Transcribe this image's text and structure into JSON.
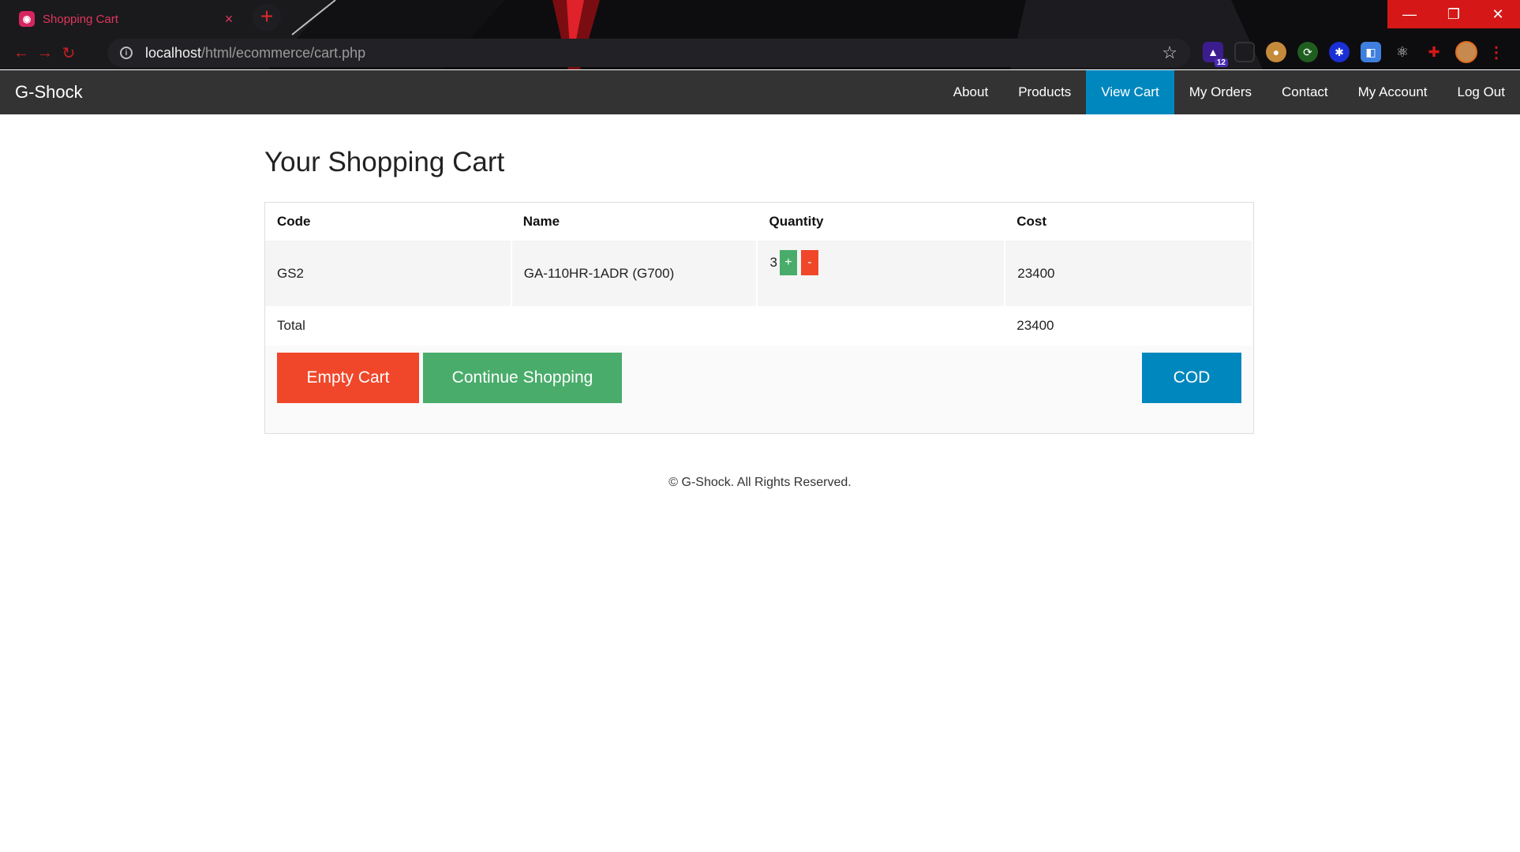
{
  "browser": {
    "tab_title": "Shopping Cart",
    "tab_close": "×",
    "new_tab": "+",
    "url_host": "localhost",
    "url_path": "/html/ecommerce/cart.php",
    "extension_badge": "12",
    "window_controls": [
      "—",
      "❐",
      "✕"
    ]
  },
  "site": {
    "brand": "G-Shock",
    "nav": [
      {
        "label": "About"
      },
      {
        "label": "Products"
      },
      {
        "label": "View Cart",
        "active": true
      },
      {
        "label": "My Orders"
      },
      {
        "label": "Contact"
      },
      {
        "label": "My Account"
      },
      {
        "label": "Log Out"
      }
    ]
  },
  "cart": {
    "title": "Your Shopping Cart",
    "columns": [
      "Code",
      "Name",
      "Quantity",
      "Cost"
    ],
    "items": [
      {
        "code": "GS2",
        "name": "GA-110HR-1ADR (G700)",
        "quantity": "3",
        "cost": "23400"
      }
    ],
    "qty_plus": "+",
    "qty_minus": "-",
    "total_label": "Total",
    "total_value": "23400",
    "buttons": {
      "empty": "Empty Cart",
      "continue": "Continue Shopping",
      "cod": "COD"
    }
  },
  "footer": "© G-Shock. All Rights Reserved.",
  "colors": {
    "navbar": "#333333",
    "active_nav": "#0087bd",
    "danger": "#f0472a",
    "success": "#49ac6b",
    "primary": "#0087bd"
  }
}
